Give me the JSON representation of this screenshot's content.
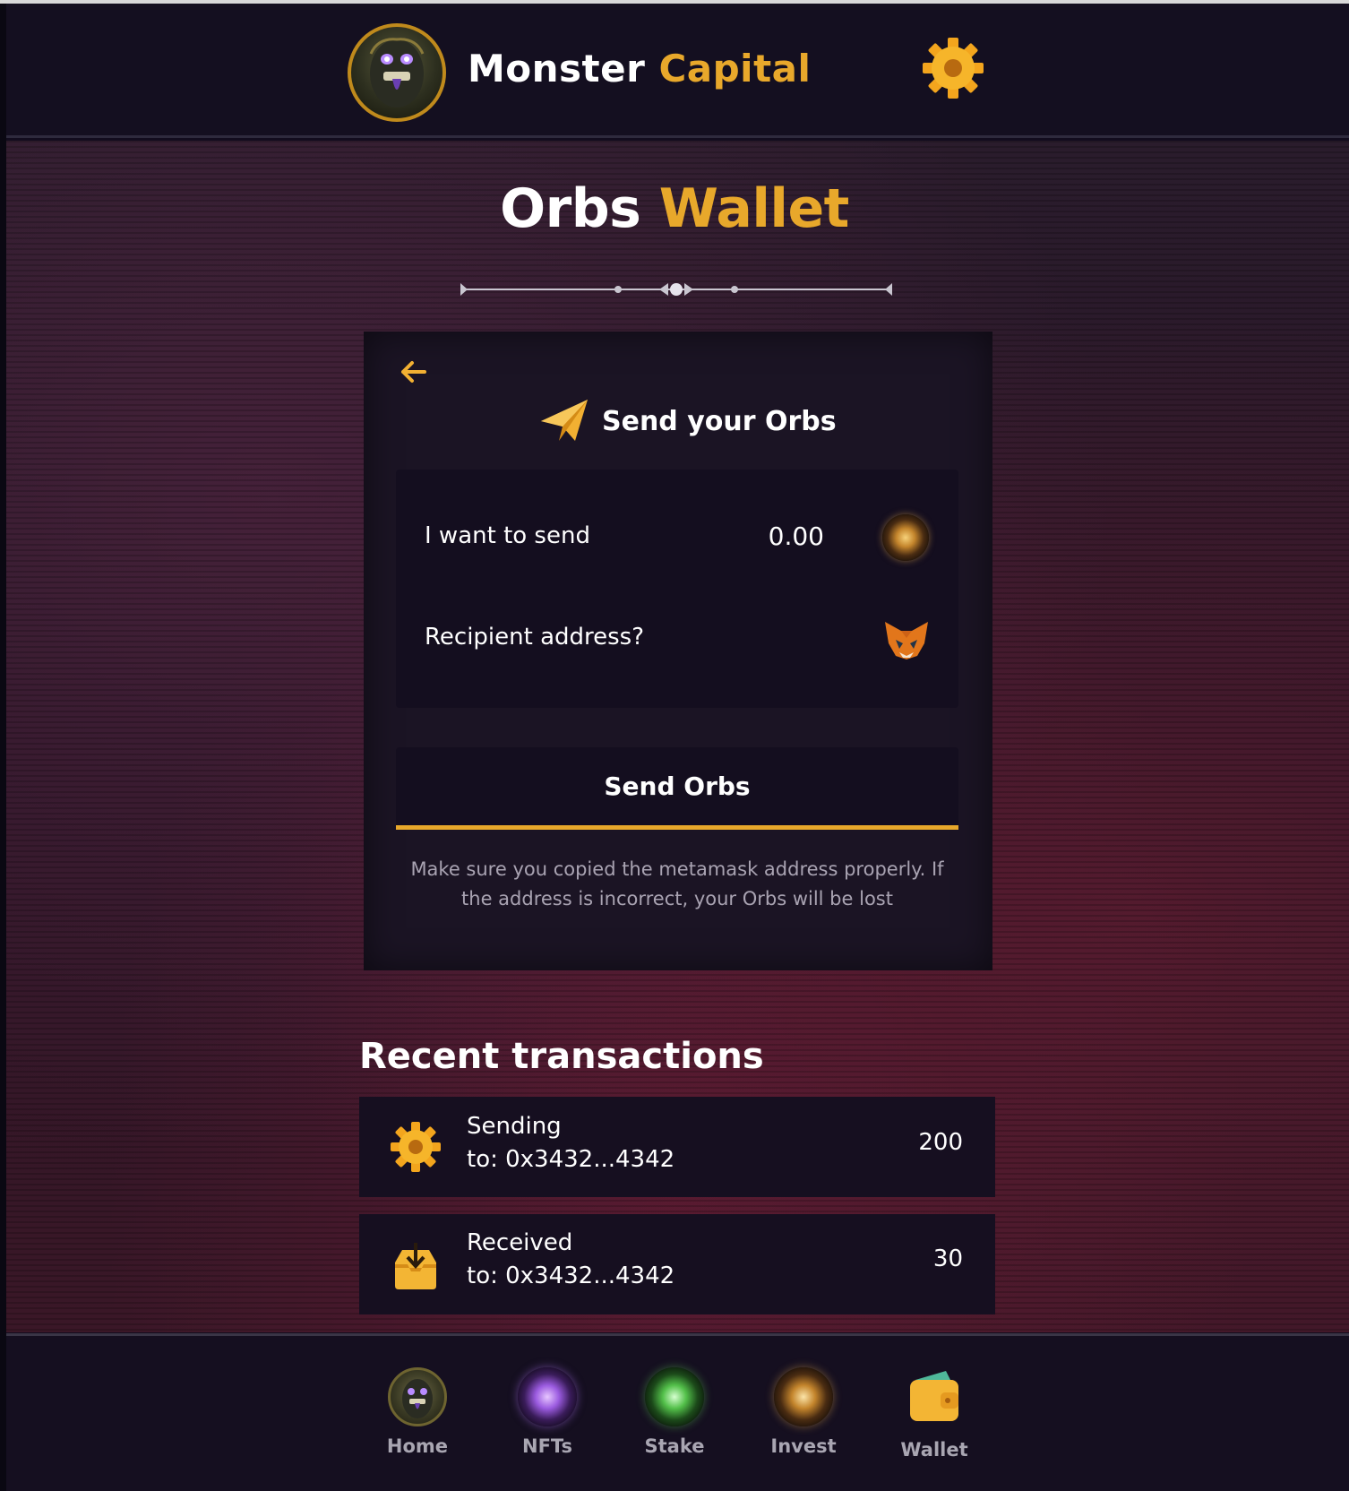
{
  "header": {
    "brand_primary": "Monster",
    "brand_accent": "Capital",
    "settings_icon": "gear-icon"
  },
  "page": {
    "title_primary": "Orbs",
    "title_accent": "Wallet"
  },
  "send_card": {
    "back_icon": "arrow-left-icon",
    "heading": "Send your Orbs",
    "heading_icon": "paper-plane-icon",
    "amount_label": "I want to send",
    "amount_value": "0.00",
    "amount_icon": "orb-coin-icon",
    "recipient_label": "Recipient address?",
    "recipient_icon": "metamask-fox-icon",
    "send_button": "Send Orbs",
    "warning": "Make sure you copied the metamask address properly. If the address is incorrect, your Orbs will be lost"
  },
  "transactions": {
    "title": "Recent transactions",
    "items": [
      {
        "type": "Sending",
        "address": "to: 0x3432...4342",
        "amount": "200",
        "icon": "gear-icon"
      },
      {
        "type": "Received",
        "address": "to: 0x3432...4342",
        "amount": "30",
        "icon": "inbox-download-icon"
      }
    ]
  },
  "bottom_nav": {
    "items": [
      {
        "label": "Home",
        "icon": "monster-avatar-icon"
      },
      {
        "label": "NFTs",
        "icon": "purple-orb-icon"
      },
      {
        "label": "Stake",
        "icon": "green-orb-icon"
      },
      {
        "label": "Invest",
        "icon": "gold-orb-icon"
      },
      {
        "label": "Wallet",
        "icon": "wallet-icon"
      }
    ]
  },
  "colors": {
    "accent": "#e8a82b",
    "background": "#120c1e",
    "card": "#1b1424",
    "muted_text": "#a9a3b2"
  }
}
